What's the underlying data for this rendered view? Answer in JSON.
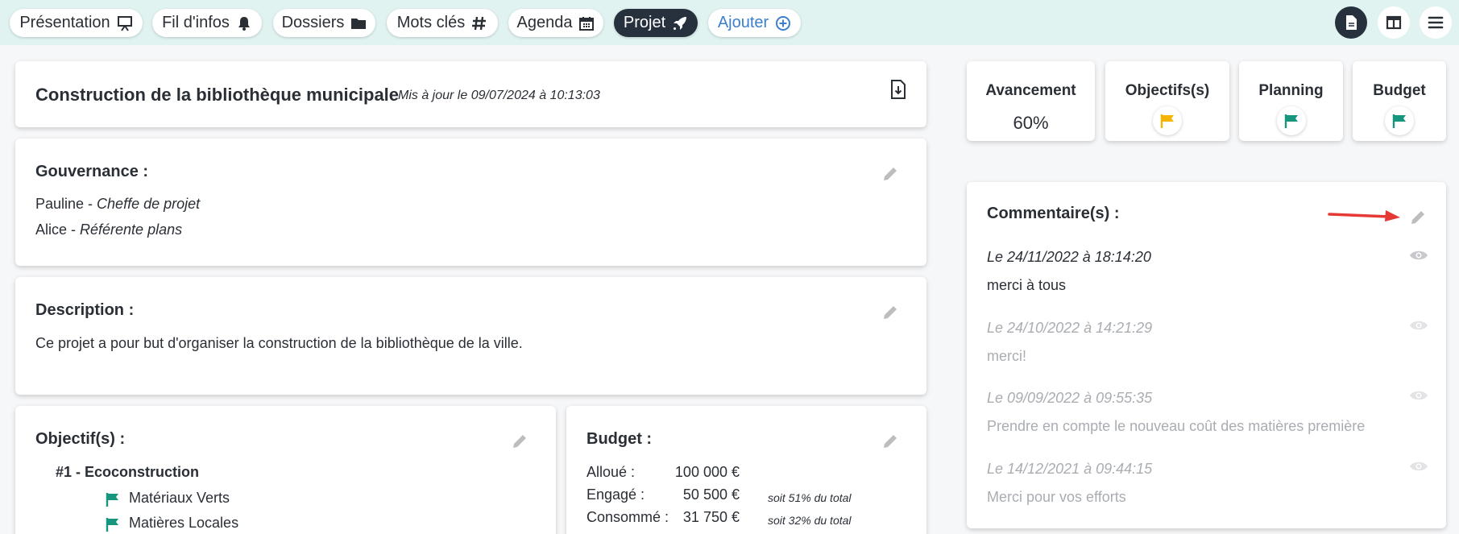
{
  "nav": {
    "tabs": [
      {
        "label": "Présentation",
        "icon": "presentation-icon"
      },
      {
        "label": "Fil d'infos",
        "icon": "bell-icon"
      },
      {
        "label": "Dossiers",
        "icon": "folder-icon"
      },
      {
        "label": "Mots clés",
        "icon": "hashtag-icon"
      },
      {
        "label": "Agenda",
        "icon": "calendar-icon"
      },
      {
        "label": "Projet",
        "icon": "rocket-icon"
      },
      {
        "label": "Ajouter",
        "icon": "plus-circle-icon"
      }
    ],
    "active_tab": "Projet"
  },
  "header": {
    "title": "Construction de la bibliothèque municipale",
    "updated": "Mis à jour le 09/07/2024 à 10:13:03"
  },
  "governance": {
    "title": "Gouvernance :",
    "members": [
      {
        "name": "Pauline",
        "role": "Cheffe de projet"
      },
      {
        "name": "Alice",
        "role": "Référente plans"
      }
    ]
  },
  "description": {
    "title": "Description :",
    "text": "Ce projet a pour but d'organiser la construction de la bibliothèque de la ville."
  },
  "objectives": {
    "title": "Objectif(s) :",
    "group": "#1 - Ecoconstruction",
    "items": [
      "Matériaux Verts",
      "Matières Locales"
    ]
  },
  "budget": {
    "title": "Budget :",
    "rows": [
      {
        "label": "Alloué :",
        "amount": "100 000 €",
        "note": ""
      },
      {
        "label": "Engagé :",
        "amount": "50 500 €",
        "note": "soit 51% du total"
      },
      {
        "label": "Consommé :",
        "amount": "31 750 €",
        "note": "soit 32% du total"
      }
    ]
  },
  "kpis": {
    "avancement": {
      "title": "Avancement",
      "value": "60%"
    },
    "objectifs": {
      "title": "Objectifs(s)",
      "status_color": "#f4b400"
    },
    "planning": {
      "title": "Planning",
      "status_color": "#16967f"
    },
    "budget": {
      "title": "Budget",
      "status_color": "#16967f"
    }
  },
  "comments": {
    "title": "Commentaire(s) :",
    "items": [
      {
        "date": "Le 24/11/2022 à 18:14:20",
        "text": "merci à tous"
      },
      {
        "date": "Le 24/10/2022 à 14:21:29",
        "text": "merci!"
      },
      {
        "date": "Le 09/09/2022 à 09:55:35",
        "text": "Prendre en compte le nouveau coût des matières première"
      },
      {
        "date": "Le 14/12/2021 à 09:44:15",
        "text": "Merci pour vos efforts"
      }
    ]
  },
  "colors": {
    "accent_dark": "#26313d",
    "link_blue": "#3b7fd0",
    "flag_green": "#16967f",
    "flag_yellow": "#f4b400",
    "arrow_red": "#e53935"
  }
}
